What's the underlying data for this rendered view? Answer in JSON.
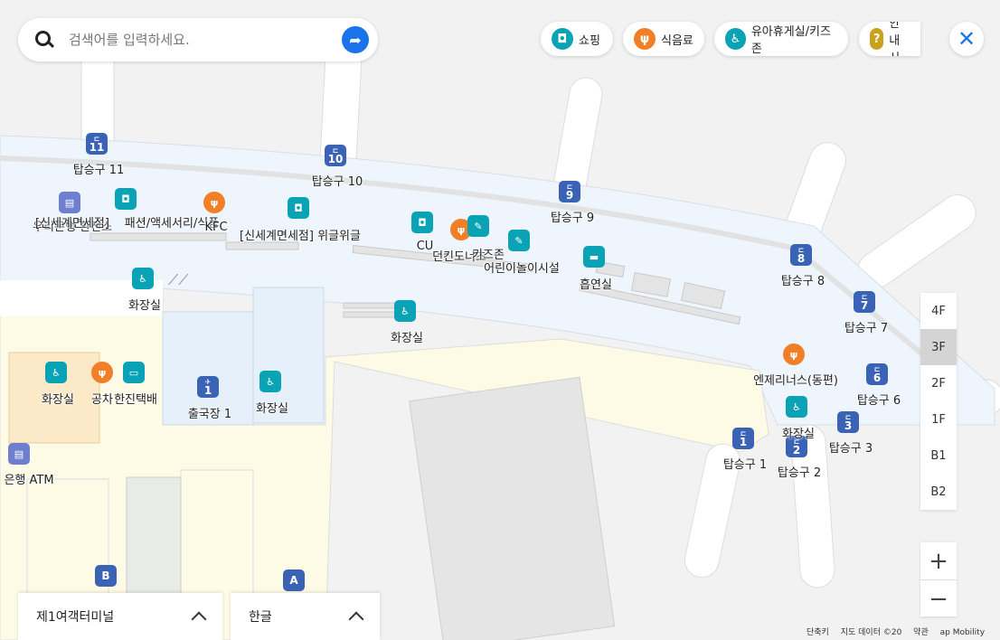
{
  "search": {
    "placeholder": "검색어를 입력하세요."
  },
  "categories": [
    {
      "label": "쇼핑",
      "icon": "shopping-bag-icon",
      "color": "#0aa3b5"
    },
    {
      "label": "식음료",
      "icon": "fork-knife-icon",
      "color": "#f07f28"
    },
    {
      "label": "유아휴게실/키즈존",
      "icon": "stroller-icon",
      "color": "#0aa3b5"
    },
    {
      "label": "안내시",
      "icon": "question-icon",
      "color": "#c9a11a"
    }
  ],
  "gates": [
    {
      "num": "11",
      "label": "탑승구 11"
    },
    {
      "num": "10",
      "label": "탑승구 10"
    },
    {
      "num": "9",
      "label": "탑승구 9"
    },
    {
      "num": "8",
      "label": "탑승구 8"
    },
    {
      "num": "7",
      "label": "탑승구 7"
    },
    {
      "num": "6",
      "label": "탑승구 6"
    },
    {
      "num": "3",
      "label": "탑승구 3"
    },
    {
      "num": "2",
      "label": "탑승구 2"
    },
    {
      "num": "1",
      "label": "탑승구 1"
    }
  ],
  "pois": {
    "bank_duty": "우리은행 환전소",
    "duty_free_overlap": "[신세계면세점]",
    "fashion": "패션/액세서리/식품",
    "kfc": "KFC",
    "wiglewigle": "[신세계면세점] 위글위글",
    "cu": "CU",
    "donut": "던킨도너츠",
    "kids_zone": "키즈존",
    "playground": "어린이놀이시설",
    "smoking": "흡연실",
    "restroom": "화장실",
    "departure": "출국장 1",
    "departure_num": "1",
    "gongcha": "공차",
    "hanjin": "한진택배",
    "angelinus": "엔제리너스(동편)",
    "atm": "은행 ATM",
    "zone_a": "A",
    "zone_b": "B"
  },
  "floors": [
    "4F",
    "3F",
    "2F",
    "1F",
    "B1",
    "B2"
  ],
  "active_floor": "3F",
  "terminal": "제1여객터미널",
  "language": "한글",
  "footer": [
    "단축키",
    "지도 데이터 ©20",
    "약관",
    "ap Mobility"
  ]
}
